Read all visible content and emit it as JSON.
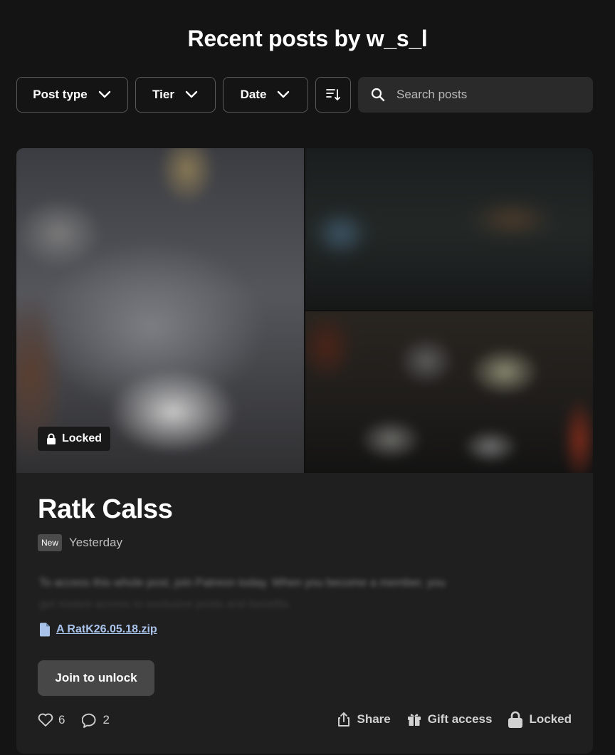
{
  "page": {
    "title": "Recent posts by w_s_l"
  },
  "filters": {
    "post_type": "Post type",
    "tier": "Tier",
    "date": "Date",
    "search_placeholder": "Search posts"
  },
  "post": {
    "locked_badge": "Locked",
    "title": "Ratk Calss",
    "new_badge": "New",
    "date": "Yesterday",
    "teaser_line1": "To access this whole post, join Patreon today. When you become a member, you",
    "teaser_line2": "get instant access to exclusive posts and benefits.",
    "attachment": "A RatK26.05.18.zip",
    "join_label": "Join to unlock",
    "likes": "6",
    "comments": "2",
    "share_label": "Share",
    "gift_label": "Gift access",
    "locked_label": "Locked"
  },
  "icons": {
    "chevron": "chevron-down-icon",
    "sort": "sort-icon",
    "search": "search-icon",
    "lock": "lock-icon",
    "file": "file-icon",
    "heart": "heart-icon",
    "comment": "comment-icon",
    "share": "share-icon",
    "gift": "gift-icon"
  },
  "colors": {
    "background": "#141414",
    "card": "#1f1f1f",
    "link": "#a9c2ea",
    "button": "#474747"
  }
}
